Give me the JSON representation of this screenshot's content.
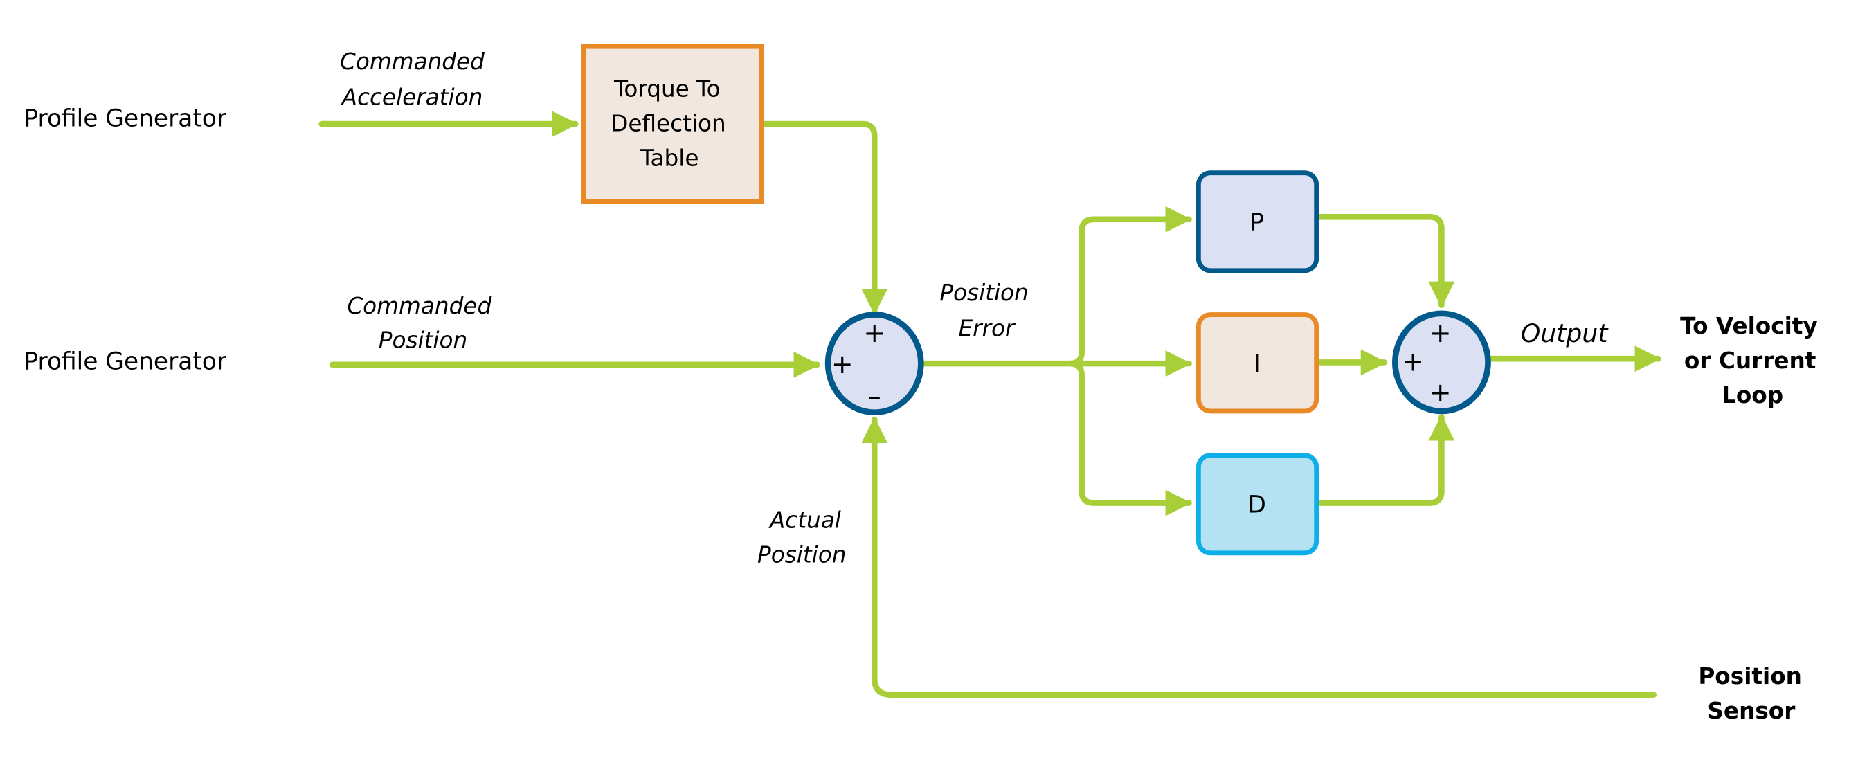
{
  "sources": {
    "top": "Profile Generator",
    "middle": "Profile Generator"
  },
  "signals": {
    "commanded_acceleration": [
      "Commanded",
      "Acceleration"
    ],
    "commanded_position": [
      "Commanded",
      "Position"
    ],
    "position_error": [
      "Position",
      "Error"
    ],
    "actual_position": [
      "Actual",
      "Position"
    ],
    "output": "Output"
  },
  "blocks": {
    "torque_table": [
      "Torque To",
      "Deflection",
      "Table"
    ],
    "p": "P",
    "i": "I",
    "d": "D"
  },
  "summing_junction_1": {
    "top": "+",
    "left": "+",
    "bottom": "–"
  },
  "summing_junction_2": {
    "top": "+",
    "left": "+",
    "bottom": "+"
  },
  "destinations": {
    "velocity_loop": [
      "To Velocity",
      "or Current",
      "Loop"
    ],
    "position_sensor": [
      "Position",
      "Sensor"
    ]
  },
  "colors": {
    "wire": "#a9cf38",
    "dark_blue": "#02598b",
    "orange": "#e88a25",
    "light_blue": "#0eaee8",
    "fill_blue": "#dbe1f2",
    "fill_beige": "#f1e7de",
    "fill_cyan": "#b5e2f2"
  }
}
